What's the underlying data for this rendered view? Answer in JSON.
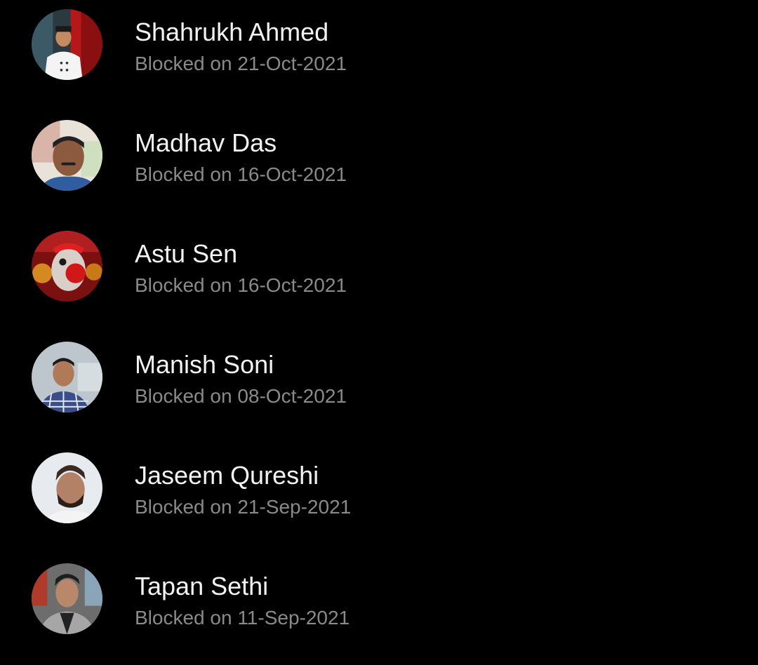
{
  "blocked_contacts": [
    {
      "name": "Shahrukh Ahmed",
      "blocked_on": "Blocked on 21-Oct-2021",
      "avatar_icon": "avatar-chef-white-coat"
    },
    {
      "name": "Madhav Das",
      "blocked_on": "Blocked on 16-Oct-2021",
      "avatar_icon": "avatar-man-mustache"
    },
    {
      "name": "Astu Sen",
      "blocked_on": "Blocked on 16-Oct-2021",
      "avatar_icon": "avatar-red-deity"
    },
    {
      "name": "Manish Soni",
      "blocked_on": "Blocked on 08-Oct-2021",
      "avatar_icon": "avatar-man-checked-shirt"
    },
    {
      "name": "Jaseem Qureshi",
      "blocked_on": "Blocked on 21-Sep-2021",
      "avatar_icon": "avatar-man-beard"
    },
    {
      "name": "Tapan Sethi",
      "blocked_on": "Blocked on 11-Sep-2021",
      "avatar_icon": "avatar-man-grey-jacket"
    }
  ],
  "colors": {
    "background": "#000000",
    "name_text": "#f2f2f2",
    "date_text": "#8a8a8a"
  }
}
